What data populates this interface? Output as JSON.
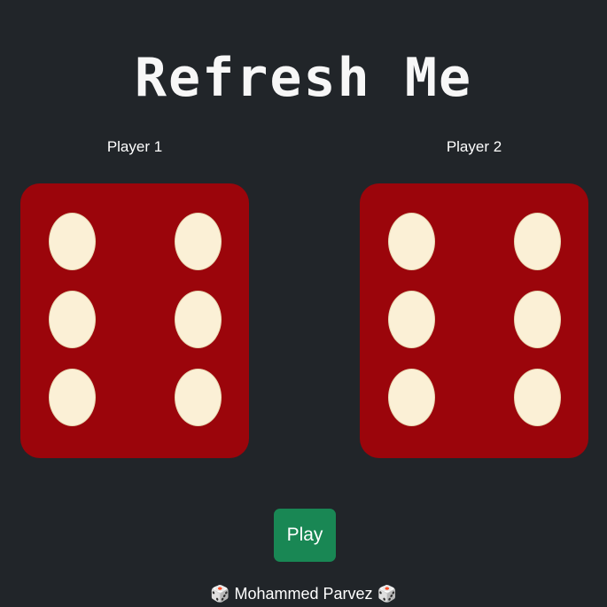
{
  "title": "Refresh Me",
  "players": [
    {
      "label": "Player 1",
      "die_value": 6
    },
    {
      "label": "Player 2",
      "die_value": 6
    }
  ],
  "play_button": {
    "label": "Play"
  },
  "footer": {
    "author": "Mohammed Parvez",
    "icon_left": "🎲",
    "icon_right": "🎲"
  },
  "colors": {
    "background": "#212529",
    "die_face": "#9b050b",
    "pip": "#fbf0d6",
    "play_button": "#198754"
  }
}
